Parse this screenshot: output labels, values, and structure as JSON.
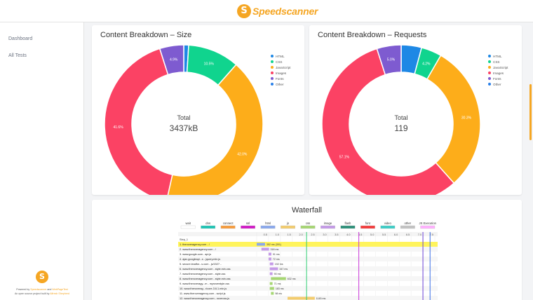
{
  "app": {
    "logo_text": "Speedscanner",
    "logo_mark": "S"
  },
  "sidebar": {
    "items": [
      {
        "label": "Dashboard"
      },
      {
        "label": "All Tests"
      }
    ],
    "footer": {
      "line1_prefix": "Powered by",
      "line1_link1": "Speedscanner",
      "line1_and": "and",
      "line1_link2": "WebPageTest",
      "line2_prefix": "An open source project built by",
      "line2_link": "Alfresh Shepherd"
    }
  },
  "cards": {
    "size": {
      "title": "Content Breakdown – Size",
      "center_label": "Total",
      "center_value": "3437kB"
    },
    "requests": {
      "title": "Content Breakdown – Requests",
      "center_label": "Total",
      "center_value": "119"
    },
    "waterfall": {
      "title": "Waterfall"
    }
  },
  "legend": [
    "HTML",
    "CSS",
    "JavaScript",
    "Images",
    "Fonts",
    "Other"
  ],
  "colors": {
    "html": "#1e88e5",
    "css": "#10d48e",
    "javascript": "#fdad1a",
    "images": "#fb4264",
    "fonts": "#7e5bd0",
    "other": "#2a80e8",
    "accent": "#f5a623"
  },
  "chart_data": [
    {
      "type": "pie",
      "title": "Content Breakdown – Size",
      "categories": [
        "HTML",
        "CSS",
        "JavaScript",
        "Images",
        "Fonts",
        "Other"
      ],
      "values": [
        1.0,
        10.5,
        42.0,
        41.6,
        4.9,
        0.0
      ],
      "labels": [
        "",
        "10.5%",
        "42.0%",
        "41.6%",
        "4.9%",
        ""
      ],
      "center": {
        "label": "Total",
        "value": "3437kB"
      }
    },
    {
      "type": "pie",
      "title": "Content Breakdown – Requests",
      "categories": [
        "HTML",
        "CSS",
        "JavaScript",
        "Images",
        "Fonts",
        "Other"
      ],
      "values": [
        4.2,
        4.2,
        30.3,
        57.1,
        5.0,
        0.0
      ],
      "labels": [
        "",
        "4.2%",
        "30.3%",
        "57.1%",
        "5.0%",
        ""
      ],
      "center": {
        "label": "Total",
        "value": "119"
      }
    }
  ],
  "waterfall": {
    "legend": [
      "wait",
      "dns",
      "connect",
      "ssl",
      "html",
      "js",
      "css",
      "image",
      "flash",
      "font",
      "video",
      "other",
      "JS Execution"
    ],
    "legend_colors": [
      "#ffffff",
      "#1fc4b4",
      "#f69c3e",
      "#d11ac6",
      "#8aa8ec",
      "#f3cc6e",
      "#a6d673",
      "#c49ae7",
      "#2d8f79",
      "#f23c3c",
      "#3ecdc6",
      "#c2c2c2",
      "#ffb1fe"
    ],
    "ticks": [
      "0.5",
      "1.0",
      "1.5",
      "2.0",
      "2.5",
      "3.0",
      "3.5",
      "4.0",
      "4.5",
      "5.0",
      "5.5",
      "6.0",
      "6.5",
      "7.0",
      "7.5"
    ],
    "step": "Step_1",
    "rows": [
      {
        "label": "1. theroveragency.com - /",
        "timing": "352 ms (301)",
        "highlight": true
      },
      {
        "label": "2. www.theroveragency.com - /",
        "timing": "318 ms",
        "highlight": false
      },
      {
        "label": "3. www.google.com - api.js",
        "timing": "91 ms",
        "highlight": false
      },
      {
        "label": "4. ajax.googleapi...s - jquery.min.js",
        "timing": "72 ms",
        "highlight": false
      },
      {
        "label": "5. secure.leadfor...s.com - js/1527...",
        "timing": "152 ms",
        "highlight": false
      },
      {
        "label": "6. www.theroveragency.com - style.min.css",
        "timing": "347 ms",
        "highlight": false
      },
      {
        "label": "7. www.theroveragency.com - style.css",
        "timing": "90 ms",
        "highlight": false
      },
      {
        "label": "8. www.theroveragency.com - style.min.css",
        "timing": "632 ms",
        "highlight": false
      },
      {
        "label": "9. www.theroveragy...m - myroverstyle.css",
        "timing": "71 ms",
        "highlight": false
      },
      {
        "label": "10. www.theroverag...r/core-3.6.1.min.js",
        "timing": "183 ms",
        "highlight": false
      },
      {
        "label": "11. www.theroveragency.com - script.js",
        "timing": "98 ms",
        "highlight": false
      },
      {
        "label": "12. www.theroveragency.com - rovercss.js",
        "timing": "1145 ms",
        "highlight": false
      },
      {
        "label": "13. maps.googleapis.com - js",
        "timing": "505 ms",
        "highlight": false
      }
    ]
  }
}
